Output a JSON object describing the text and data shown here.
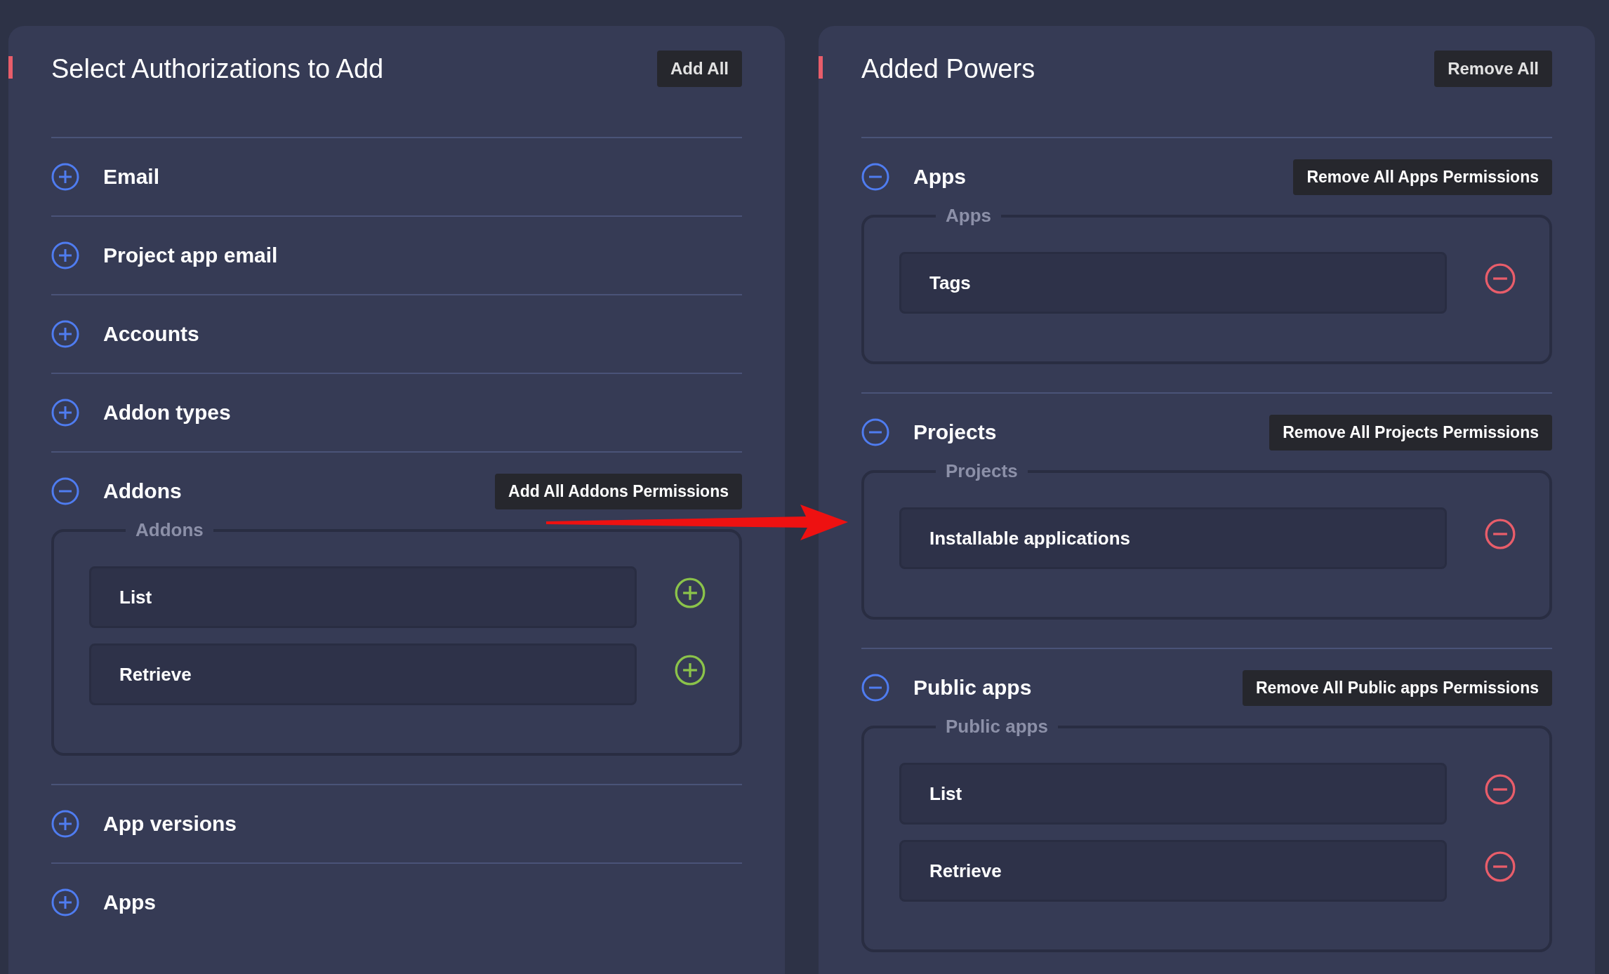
{
  "panels": [
    {
      "title": "Select Authorizations to Add",
      "button": "Add All",
      "sections": [
        {
          "name": "Email",
          "expanded": false
        },
        {
          "name": "Project app email",
          "expanded": false
        },
        {
          "name": "Accounts",
          "expanded": false
        },
        {
          "name": "Addon types",
          "expanded": false
        },
        {
          "name": "Addons",
          "expanded": true,
          "button": "Add All Addons Permissions",
          "group": {
            "legend": "Addons",
            "items": [
              {
                "label": "List",
                "kind": "add"
              },
              {
                "label": "Retrieve",
                "kind": "add"
              }
            ]
          }
        },
        {
          "name": "App versions",
          "expanded": false
        },
        {
          "name": "Apps",
          "expanded": false
        }
      ]
    },
    {
      "title": "Added Powers",
      "button": "Remove All",
      "sections": [
        {
          "name": "Apps",
          "expanded": true,
          "button": "Remove All Apps Permissions",
          "group": {
            "legend": "Apps",
            "items": [
              {
                "label": "Tags",
                "kind": "remove"
              }
            ]
          }
        },
        {
          "name": "Projects",
          "expanded": true,
          "button": "Remove All Projects Permissions",
          "group": {
            "legend": "Projects",
            "items": [
              {
                "label": "Installable applications",
                "kind": "remove"
              }
            ]
          }
        },
        {
          "name": "Public apps",
          "expanded": true,
          "button": "Remove All Public apps Permissions",
          "group": {
            "legend": "Public apps",
            "items": [
              {
                "label": "List",
                "kind": "remove"
              },
              {
                "label": "Retrieve",
                "kind": "remove"
              }
            ]
          }
        }
      ]
    }
  ]
}
